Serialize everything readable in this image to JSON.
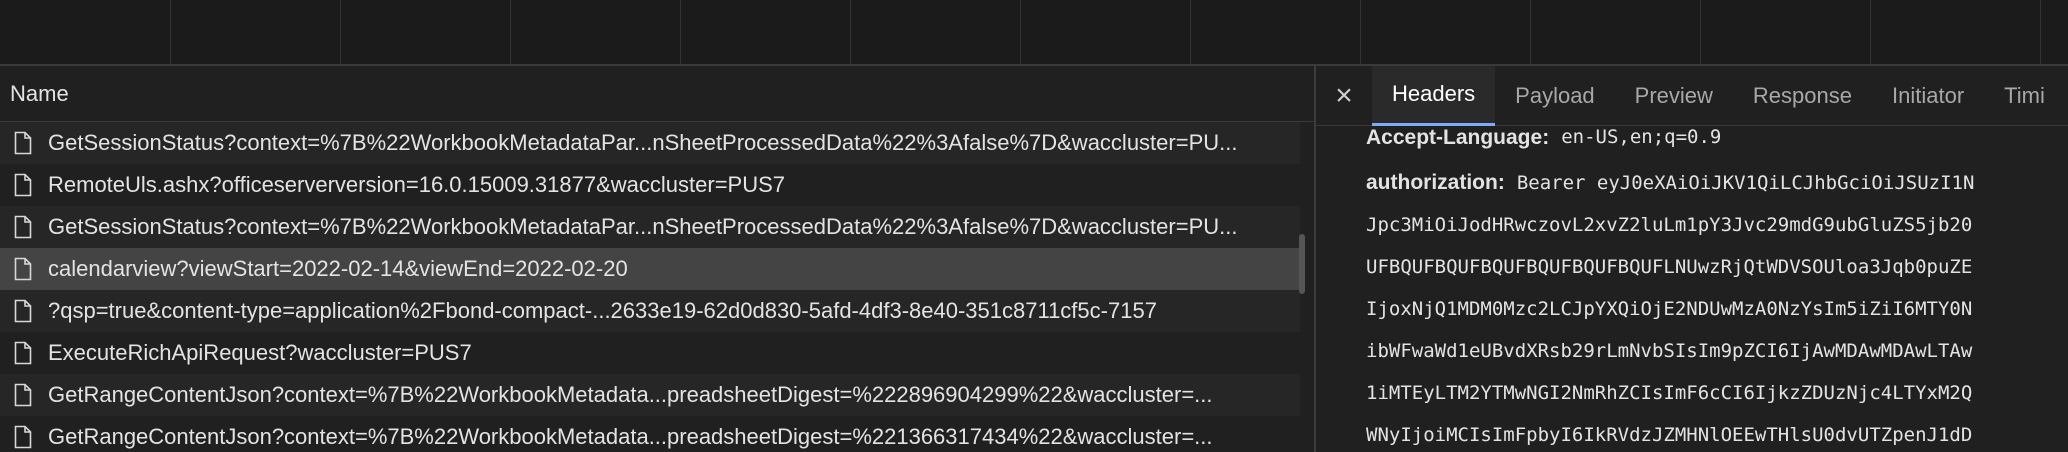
{
  "name_column": {
    "label": "Name"
  },
  "requests": [
    {
      "name": "GetSessionStatus?context=%7B%22WorkbookMetadataPar...nSheetProcessedData%22%3Afalse%7D&waccluster=PU..."
    },
    {
      "name": "RemoteUls.ashx?officeserverversion=16.0.15009.31877&waccluster=PUS7"
    },
    {
      "name": "GetSessionStatus?context=%7B%22WorkbookMetadataPar...nSheetProcessedData%22%3Afalse%7D&waccluster=PU..."
    },
    {
      "name": "calendarview?viewStart=2022-02-14&viewEnd=2022-02-20"
    },
    {
      "name": "?qsp=true&content-type=application%2Fbond-compact-...2633e19-62d0d830-5afd-4df3-8e40-351c8711cf5c-7157"
    },
    {
      "name": "ExecuteRichApiRequest?waccluster=PUS7"
    },
    {
      "name": "GetRangeContentJson?context=%7B%22WorkbookMetadata...preadsheetDigest=%222896904299%22&waccluster=..."
    },
    {
      "name": "GetRangeContentJson?context=%7B%22WorkbookMetadata...preadsheetDigest=%221366317434%22&waccluster=..."
    }
  ],
  "selected_index": 3,
  "close_symbol": "×",
  "tabs": [
    {
      "label": "Headers"
    },
    {
      "label": "Payload"
    },
    {
      "label": "Preview"
    },
    {
      "label": "Response"
    },
    {
      "label": "Initiator"
    },
    {
      "label": "Timi"
    }
  ],
  "active_tab": 0,
  "headers": {
    "accept_language": {
      "key": "Accept-Language:",
      "value": "en-US,en;q=0.9"
    },
    "authorization": {
      "key": "authorization:",
      "lines": [
        "Bearer eyJ0eXAiOiJKV1QiLCJhbGciOiJSUzI1N",
        "Jpc3MiOiJodHRwczovL2xvZ2luLm1pY3Jvc29mdG9ubGluZS5jb20",
        "UFBQUFBQUFBQUFBQUFBQUFBQUFLNUwzRjQtWDVSOUloa3Jqb0puZE",
        "IjoxNjQ1MDM0Mzc2LCJpYXQiOjE2NDUwMzA0NzYsIm5iZiI6MTY0N",
        "ibWFwaWd1eUBvdXRsb29rLmNvbSIsIm9pZCI6IjAwMDAwMDAwLTAw",
        "1iMTEyLTM2YTMwNGI2NmRhZCIsImF6cCI6IjkzZDUzNjc4LTYxM2Q",
        "WNyIjoiMCIsImFpbyI6IkRVdzJZMHNlOEEwTHlsU0dvUTZpenJ1dD"
      ]
    }
  },
  "colors": {
    "background": "#202020",
    "selected_row": "#444444",
    "active_tab_underline": "#7cacf8"
  },
  "icons": {
    "request_row": "file-icon",
    "close": "close-icon"
  }
}
